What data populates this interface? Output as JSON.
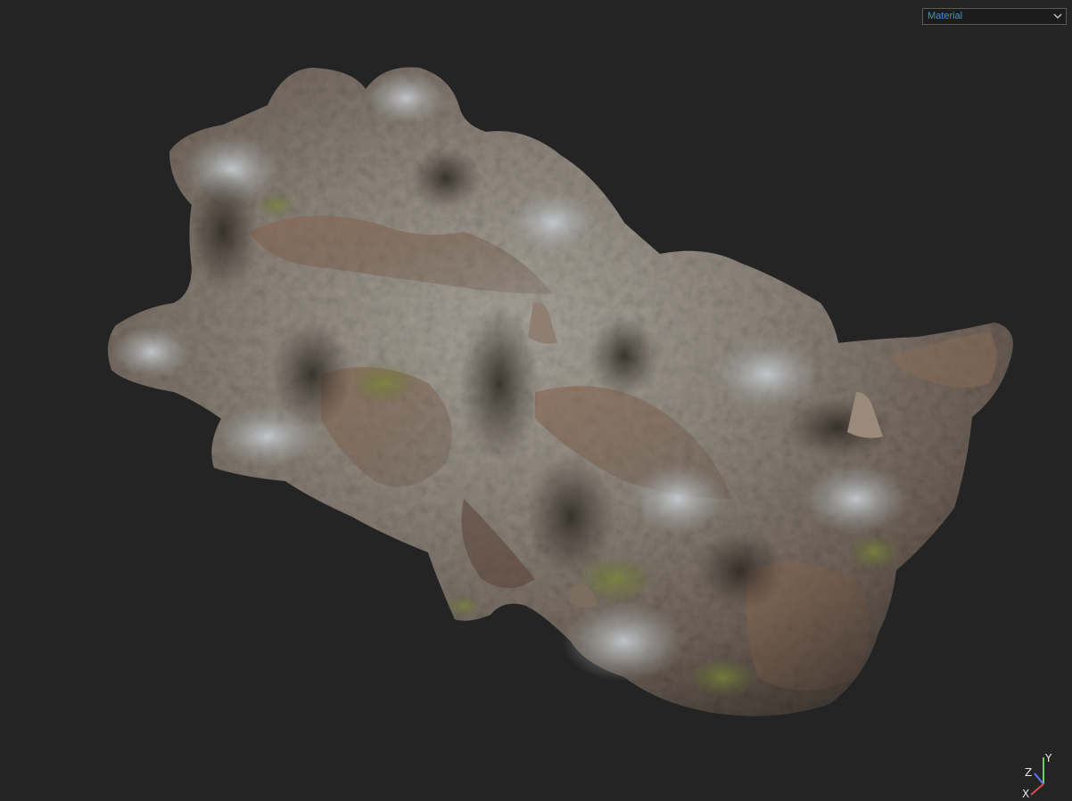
{
  "viewport": {
    "background_color": "#242424"
  },
  "shading_mode": {
    "selected": "Material",
    "text_color": "#3d8ee6",
    "icon": "chevron-down-icon"
  },
  "axis_gizmo": {
    "x_label": "X",
    "y_label": "Y",
    "z_label": "Z",
    "x_color": "#e04b4b",
    "y_color": "#5cd65c",
    "z_color": "#5a7bf0"
  }
}
